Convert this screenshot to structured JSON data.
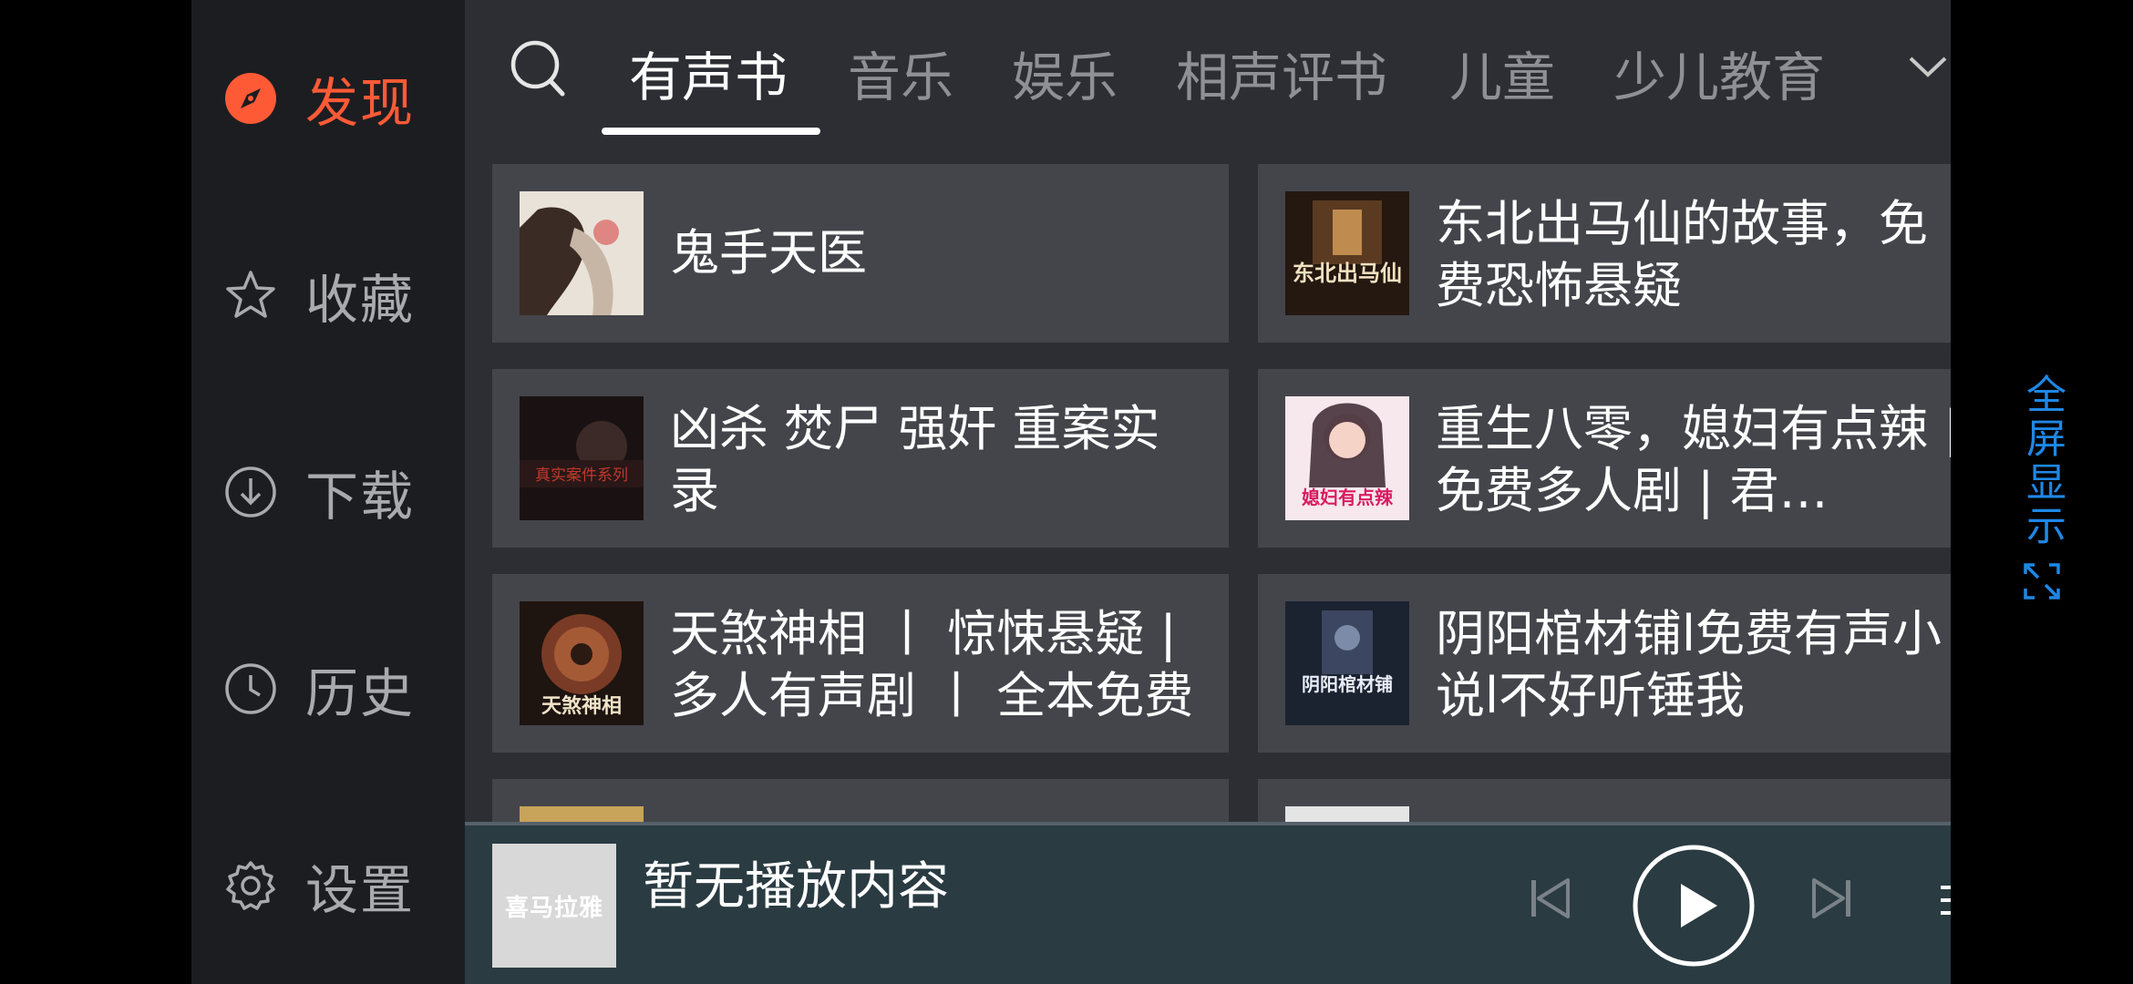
{
  "sidebar": {
    "items": [
      {
        "label": "发现",
        "icon": "compass-icon",
        "active": true
      },
      {
        "label": "收藏",
        "icon": "star-icon"
      },
      {
        "label": "下载",
        "icon": "download-icon"
      },
      {
        "label": "历史",
        "icon": "clock-icon"
      },
      {
        "label": "设置",
        "icon": "gear-icon"
      }
    ]
  },
  "tabs": [
    {
      "label": "有声书",
      "active": true
    },
    {
      "label": "音乐"
    },
    {
      "label": "娱乐"
    },
    {
      "label": "相声评书"
    },
    {
      "label": "儿童"
    },
    {
      "label": "少儿教育"
    }
  ],
  "cards": [
    {
      "title": "鬼手天医",
      "cover_text": ""
    },
    {
      "title": "东北出马仙的故事，免费恐怖悬疑",
      "cover_text": "东北出马仙"
    },
    {
      "title": "凶杀 焚尸 强奸 重案实录",
      "cover_text": "真实案件系列"
    },
    {
      "title": "重生八零，媳妇有点辣 | 免费多人剧 | 君…",
      "cover_text": "媳妇有点辣"
    },
    {
      "title": "天煞神相 丨 惊悚悬疑 | 多人有声剧 丨 全本免费",
      "cover_text": "天煞神相"
    },
    {
      "title": "阴阳棺材铺l免费有声小说l不好听锤我",
      "cover_text": "阴阳棺材铺"
    }
  ],
  "player": {
    "now_playing": "暂无播放内容",
    "thumb_text": "喜马拉雅"
  },
  "rightbar": {
    "fullscreen_label": "全屏显示"
  },
  "colors": {
    "accent": "#ff5a36",
    "fullscreen_blue": "#1e88e5"
  }
}
